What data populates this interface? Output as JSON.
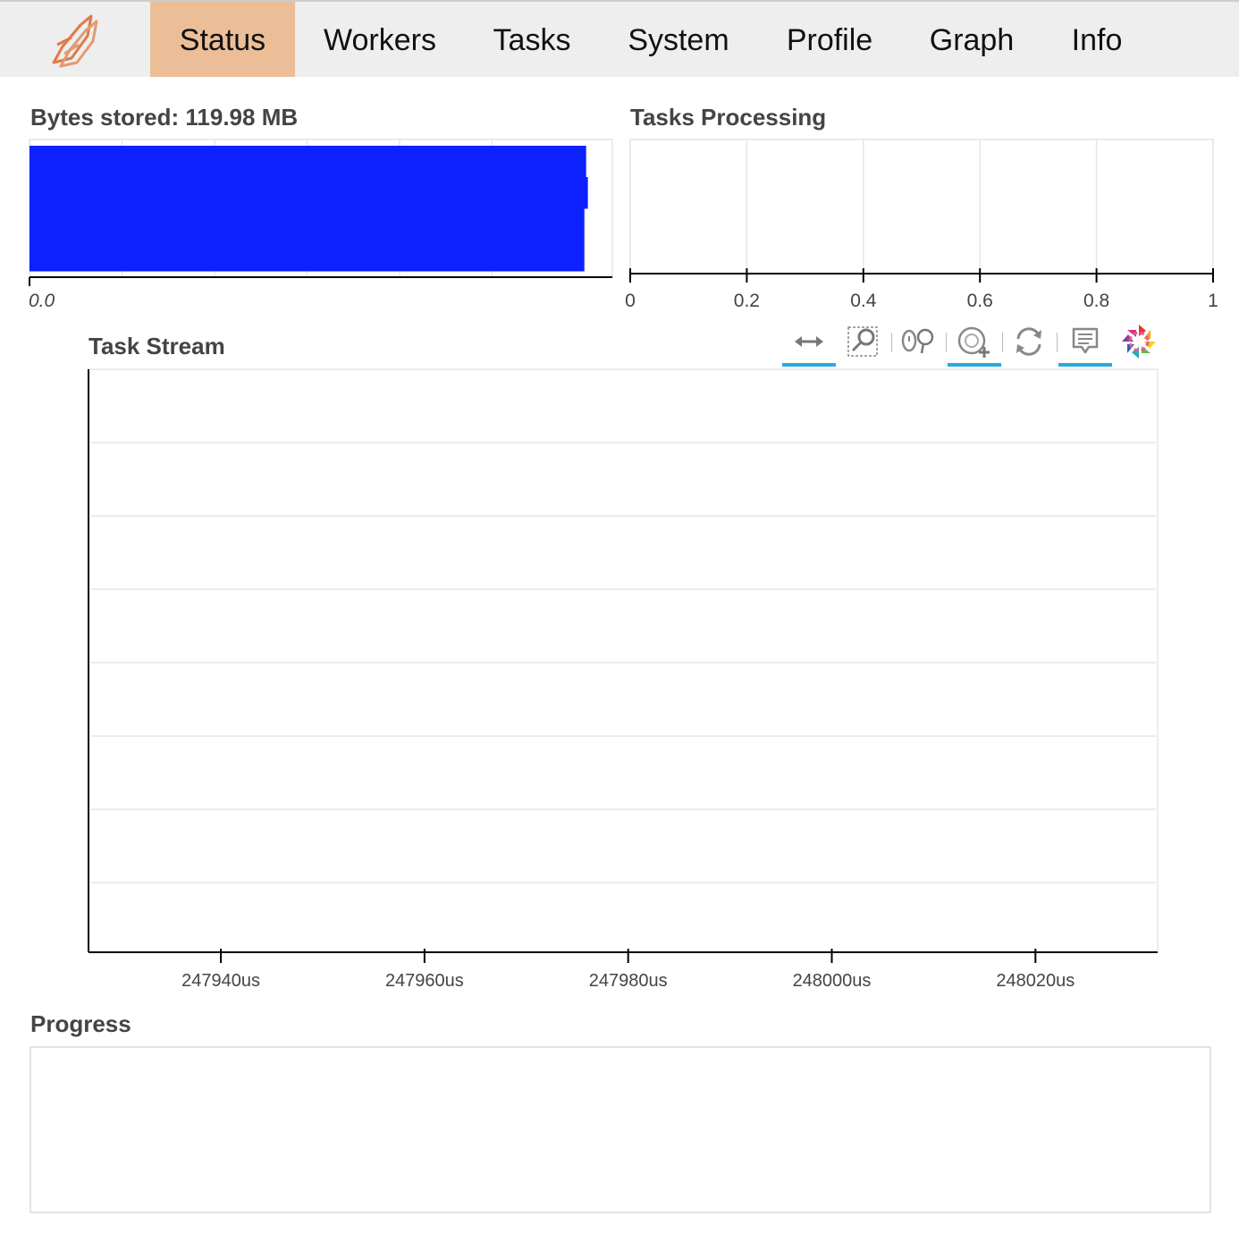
{
  "navbar": {
    "logo_icon": "dask-logo-icon",
    "items": [
      {
        "label": "Status",
        "active": true
      },
      {
        "label": "Workers",
        "active": false
      },
      {
        "label": "Tasks",
        "active": false
      },
      {
        "label": "System",
        "active": false
      },
      {
        "label": "Profile",
        "active": false
      },
      {
        "label": "Graph",
        "active": false
      },
      {
        "label": "Info",
        "active": false
      }
    ],
    "active_color": "#ecbe98"
  },
  "bytes_stored": {
    "title": "Bytes stored: 119.98 MB",
    "tick_label": "0.0",
    "bar_color": "#0d21ff"
  },
  "tasks_processing": {
    "title": "Tasks Processing",
    "ticks": [
      "0",
      "0.2",
      "0.4",
      "0.6",
      "0.8",
      "1"
    ]
  },
  "task_stream": {
    "title": "Task Stream",
    "ticks": [
      "247940us",
      "247960us",
      "247980us",
      "248000us",
      "248020us"
    ],
    "toolbar": [
      {
        "name": "xpan-tool",
        "icon": "pan-horizontal-icon",
        "active": true
      },
      {
        "name": "box-zoom-tool",
        "icon": "box-zoom-icon",
        "active": false
      },
      {
        "name": "wheel-zoom-tool",
        "icon": "wheel-zoom-icon",
        "active": false
      },
      {
        "name": "tap-tool",
        "icon": "tap-icon",
        "active": true
      },
      {
        "name": "reset-tool",
        "icon": "reset-icon",
        "active": false
      },
      {
        "name": "hover-tool",
        "icon": "hover-icon",
        "active": true
      },
      {
        "name": "bokeh-logo",
        "icon": "bokeh-logo-icon",
        "active": false
      }
    ],
    "tool_active_color": "#26aae1"
  },
  "progress": {
    "title": "Progress"
  },
  "chart_data": [
    {
      "type": "bar",
      "title": "Bytes stored: 119.98 MB",
      "orientation": "horizontal",
      "tick_labels": [
        "0.0"
      ],
      "series": [
        {
          "values": [
            0.955,
            0.958,
            0.952,
            0.952
          ]
        }
      ],
      "grid": true
    },
    {
      "type": "bar",
      "title": "Tasks Processing",
      "xlim": [
        0,
        1
      ],
      "tick_labels": [
        "0",
        "0.2",
        "0.4",
        "0.6",
        "0.8",
        "1"
      ],
      "series": [],
      "grid": true
    },
    {
      "type": "bar",
      "title": "Task Stream",
      "xlim": [
        247927,
        248032
      ],
      "tick_labels": [
        "247940us",
        "247960us",
        "247980us",
        "248000us",
        "248020us"
      ],
      "x_ticks": [
        247940,
        247960,
        247980,
        248000,
        248020
      ],
      "series": [],
      "grid": true
    }
  ]
}
